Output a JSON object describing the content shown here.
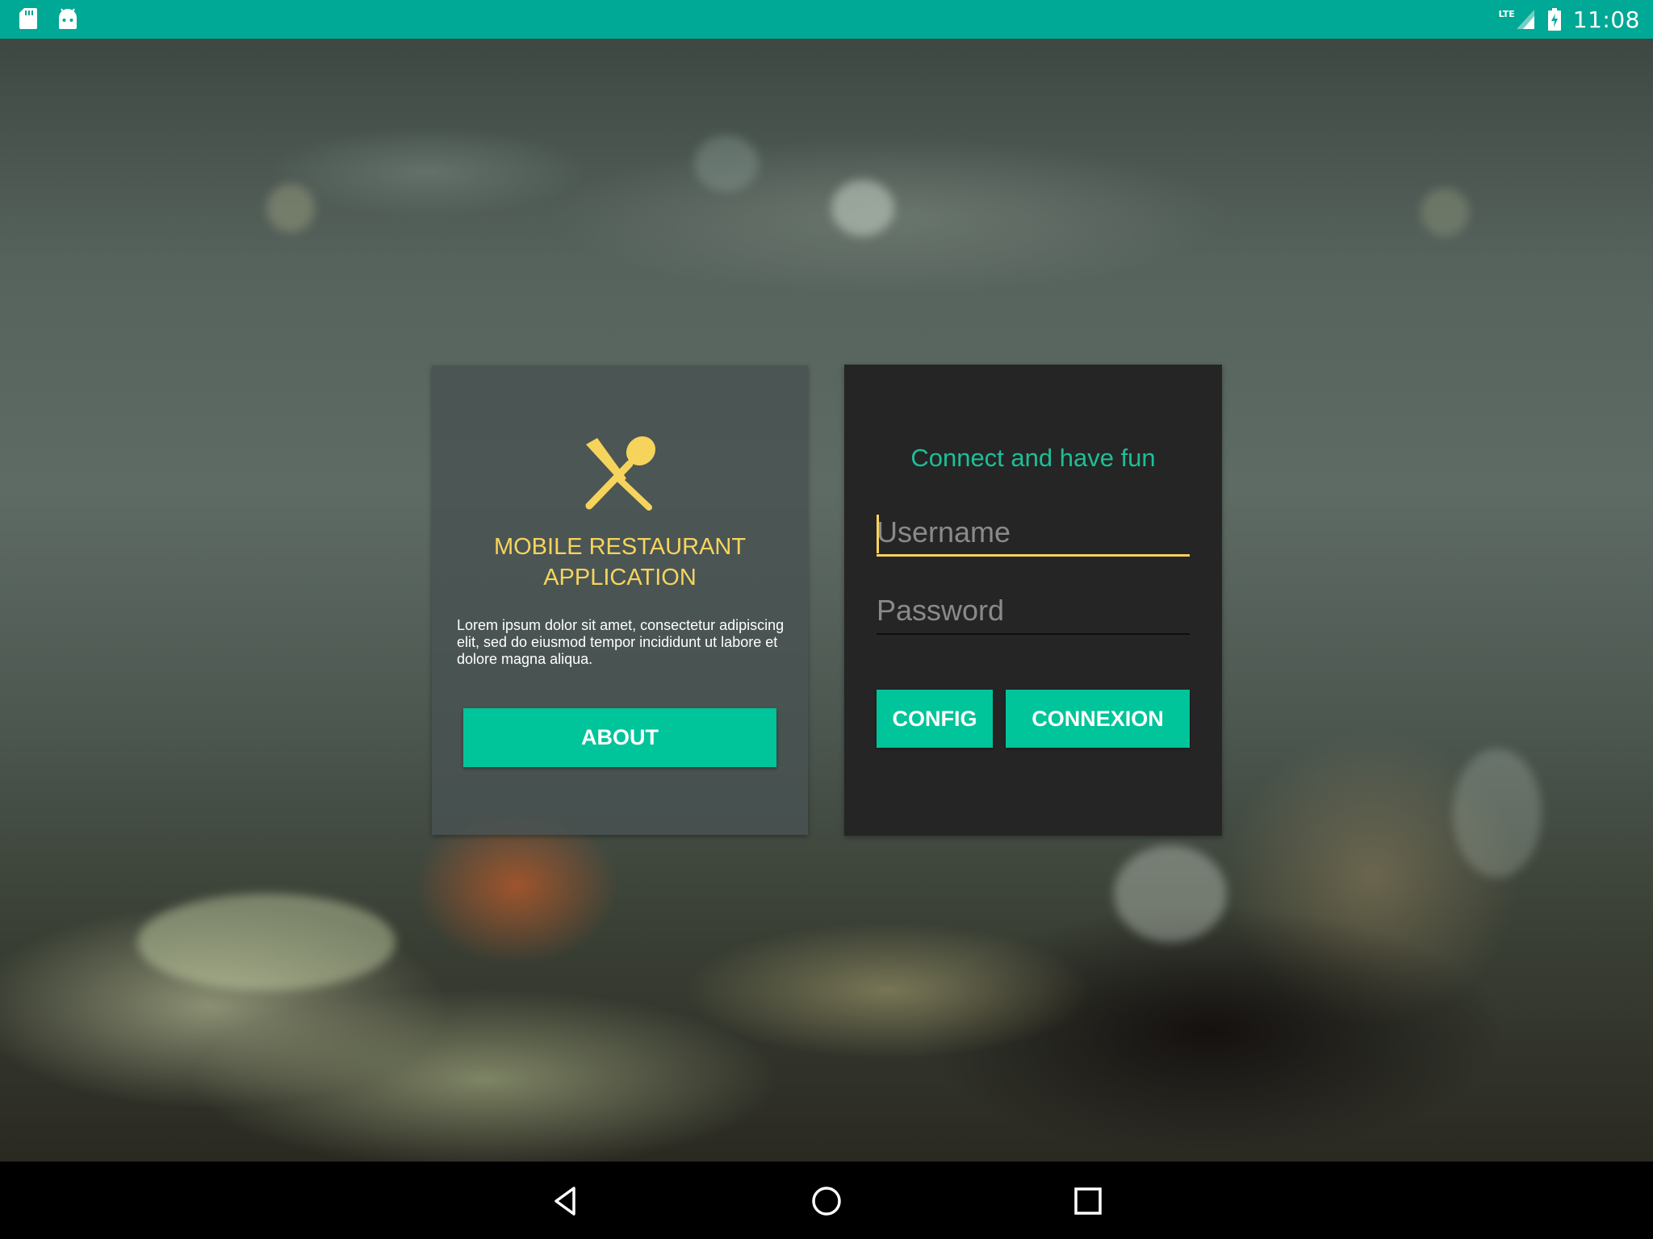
{
  "status_bar": {
    "time": "11:08",
    "network": "LTE",
    "color": "#00a896"
  },
  "about_card": {
    "title": "MOBILE RESTAURANT APPLICATION",
    "description": "Lorem ipsum dolor sit amet, consectetur adipiscing elit, sed do eiusmod tempor incididunt ut labore et dolore magna aliqua.",
    "about_label": "ABOUT",
    "icon": "utensils-icon"
  },
  "login_card": {
    "heading": "Connect and have fun",
    "username_placeholder": "Username",
    "username_value": "",
    "password_placeholder": "Password",
    "password_value": "",
    "config_label": "CONFIG",
    "connexion_label": "CONNEXION"
  },
  "colors": {
    "accent": "#00c49a",
    "title_yellow": "#f6d45c",
    "heading_green": "#1dbf97"
  }
}
